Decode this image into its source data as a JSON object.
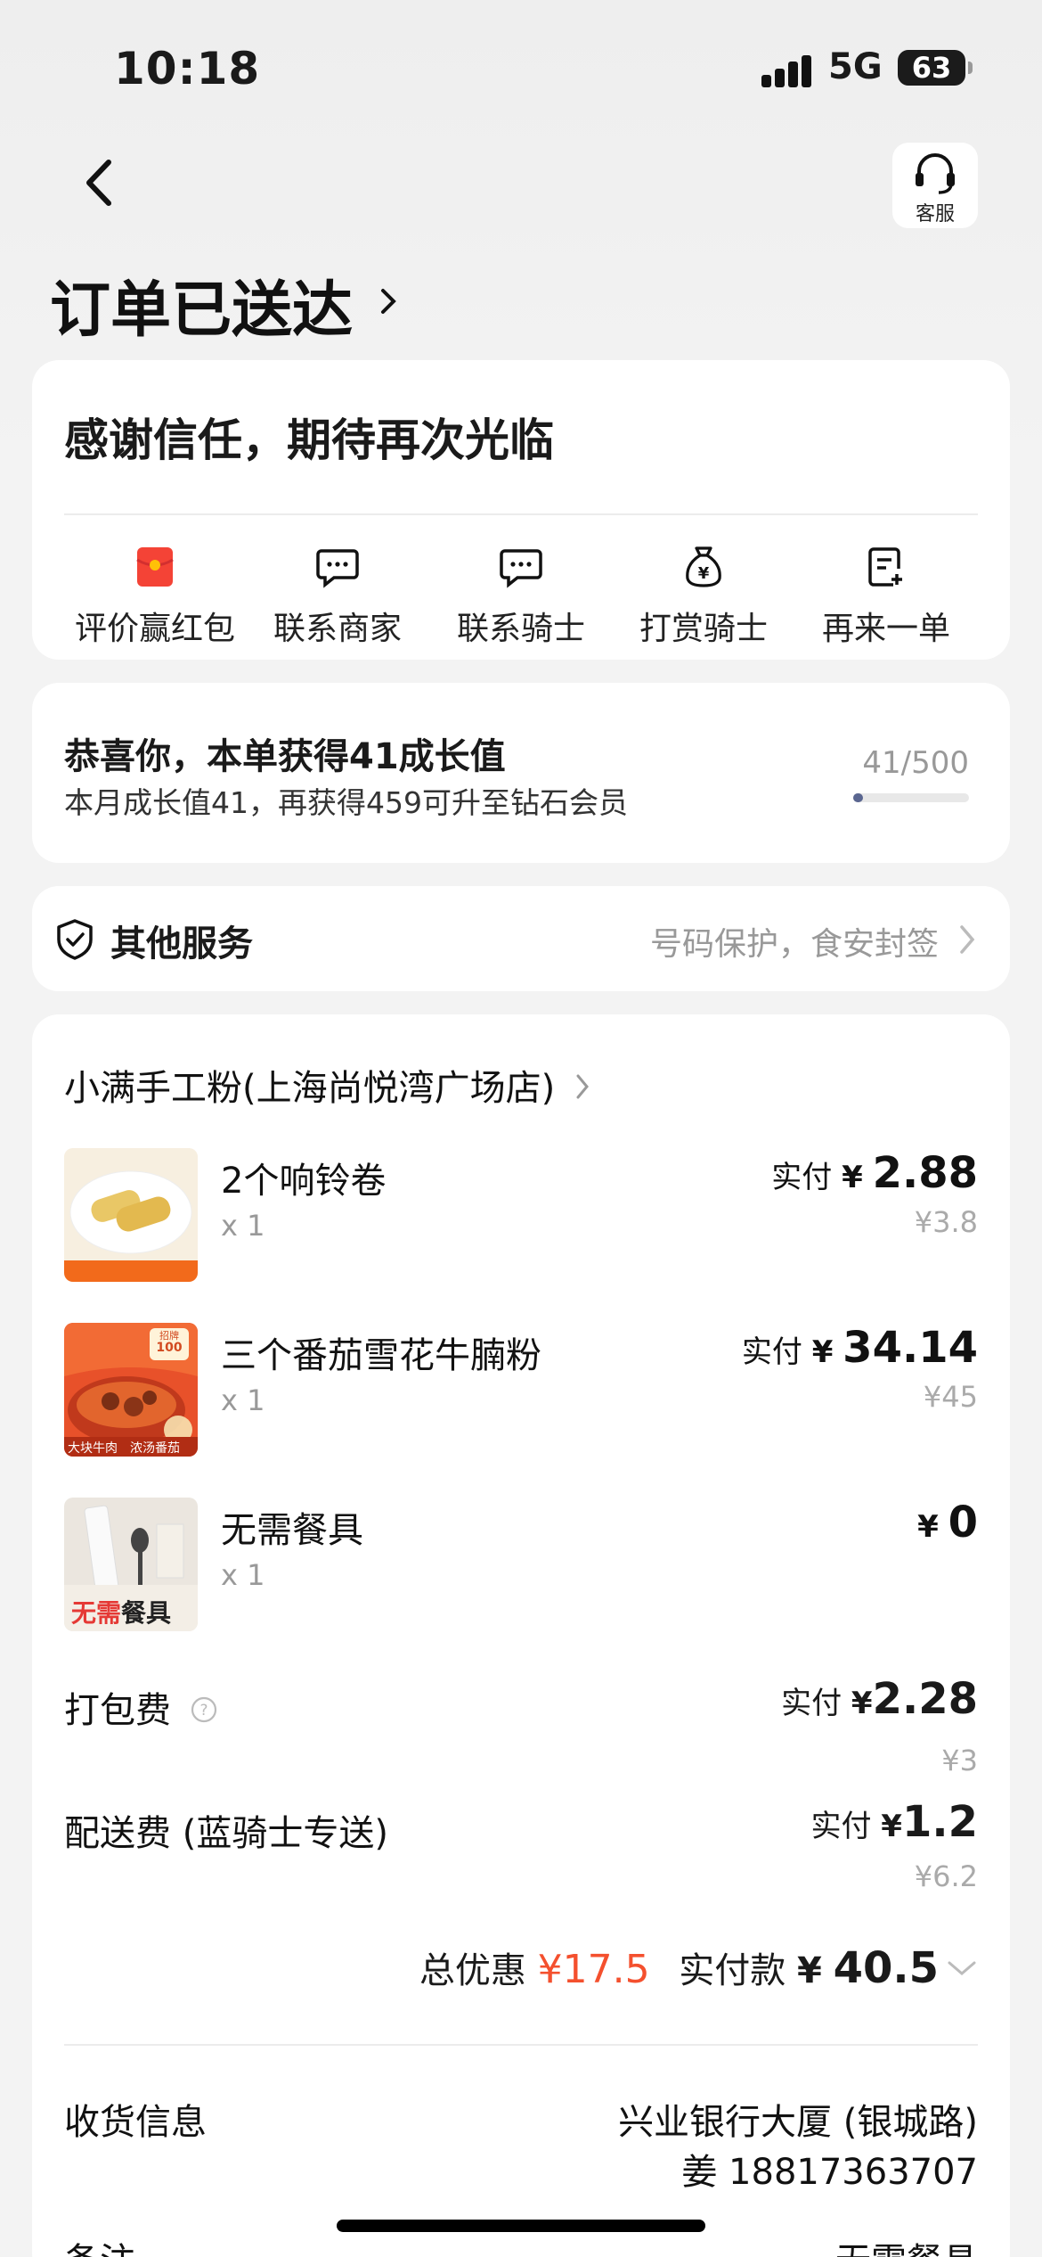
{
  "status_bar": {
    "time": "10:18",
    "network": "5G",
    "battery": "63"
  },
  "header": {
    "title": "订单已送达",
    "customer_service_label": "客服",
    "back_icon": "chevron-left-icon",
    "service_icon": "headset-icon"
  },
  "thanks_card": {
    "message": "感谢信任，期待再次光临",
    "actions": [
      {
        "label": "评价赢红包",
        "icon": "red-envelope-icon"
      },
      {
        "label": "联系商家",
        "icon": "chat-bubble-icon"
      },
      {
        "label": "联系骑士",
        "icon": "chat-bubble-icon"
      },
      {
        "label": "打赏骑士",
        "icon": "money-bag-icon"
      },
      {
        "label": "再来一单",
        "icon": "reorder-icon"
      }
    ]
  },
  "growth_card": {
    "title": "恭喜你，本单获得41成长值",
    "subtitle": "本月成长值41，再获得459可升至钻石会员",
    "progress_text": "41/500",
    "progress_fraction": 0.082
  },
  "services_card": {
    "title": "其他服务",
    "hint": "号码保护，食安封签"
  },
  "order": {
    "shop_name": "小满手工粉(上海尚悦湾广场店)",
    "items": [
      {
        "name": "2个响铃卷",
        "qty": "x 1",
        "paid_label": "实付",
        "currency": "¥",
        "price": "2.88",
        "original": "¥3.8"
      },
      {
        "name": "三个番茄雪花牛腩粉",
        "qty": "x 1",
        "paid_label": "实付",
        "currency": "¥",
        "price": "34.14",
        "original": "¥45",
        "thumb_badge_top": "招牌",
        "thumb_badge_num": "100",
        "thumb_caption_left": "大块牛肉",
        "thumb_caption_right": "浓汤番茄"
      },
      {
        "name": "无需餐具",
        "qty": "x 1",
        "paid_label": "",
        "currency": "¥",
        "price": "0",
        "original": "",
        "thumb_text_red": "无需",
        "thumb_text_dark": "餐具"
      }
    ],
    "packing_fee": {
      "label": "打包费",
      "paid_label": "实付",
      "currency": "¥",
      "price": "2.28",
      "original": "¥3"
    },
    "delivery_fee": {
      "label": "配送费 (蓝骑士专送)",
      "paid_label": "实付",
      "currency": "¥",
      "price": "1.2",
      "original": "¥6.2"
    },
    "summary": {
      "discount_label": "总优惠",
      "discount_value": "¥17.5",
      "paid_label": "实付款",
      "currency": "¥",
      "paid_value": "40.5"
    },
    "delivery_info": {
      "label": "收货信息",
      "address": "兴业银行大厦 (银城路)",
      "contact": "姜 18817363707"
    },
    "remark": {
      "label": "备注",
      "value": "无需餐具"
    }
  },
  "colors": {
    "accent_red": "#f4502e",
    "progress": "#5a6690"
  }
}
